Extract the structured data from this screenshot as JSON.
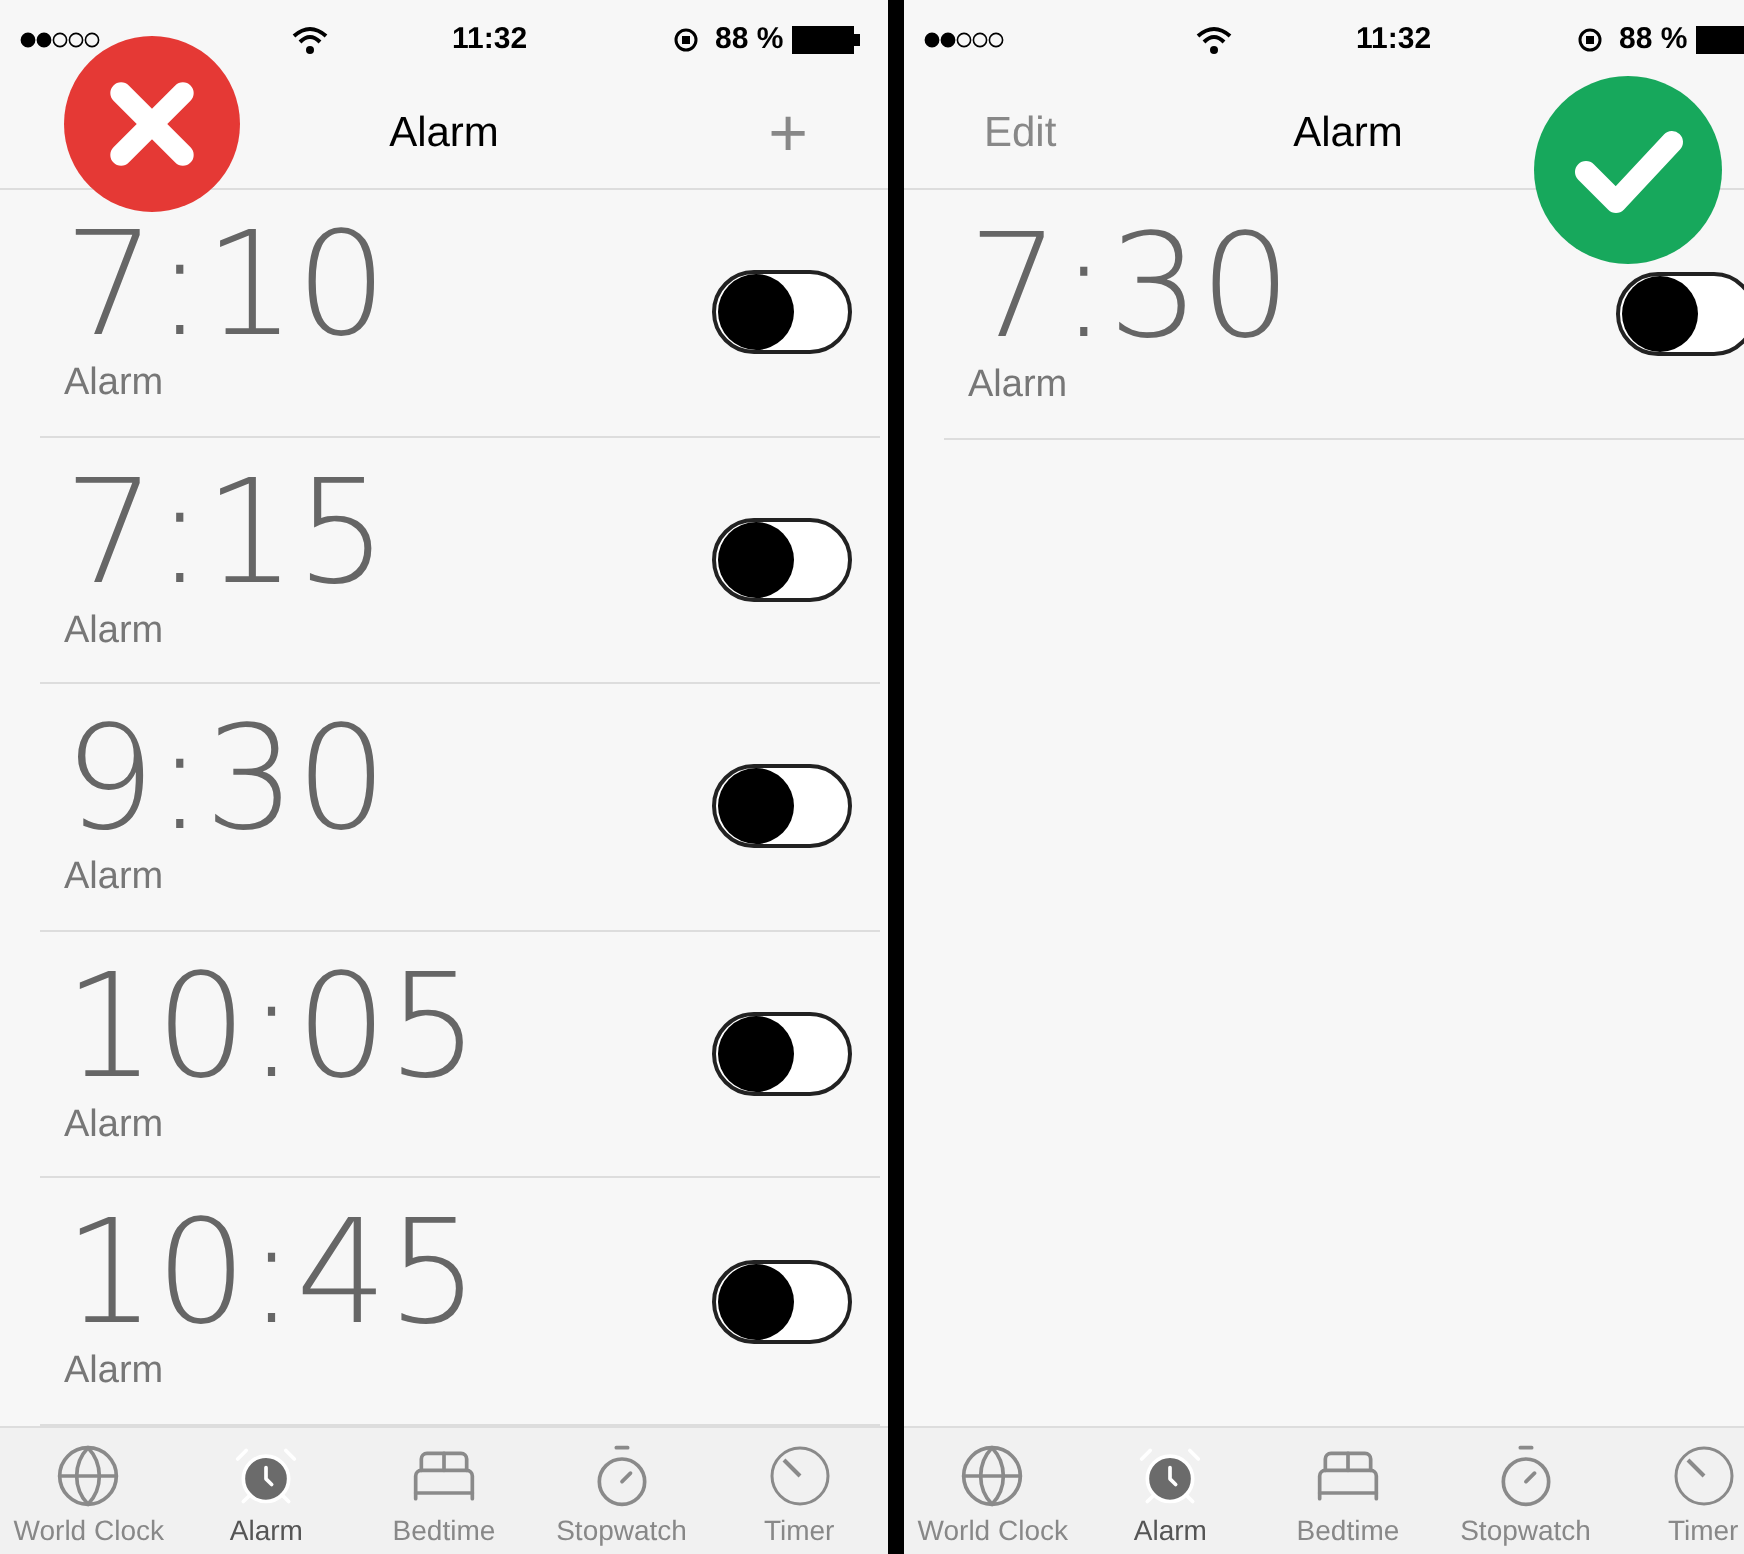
{
  "screens": [
    {
      "status": {
        "time": "11:32",
        "battery": "88 %"
      },
      "nav": {
        "title": "Alarm",
        "add": "+"
      },
      "verdict": {
        "kind": "wrong"
      },
      "alarms": [
        {
          "time": "7:10",
          "label": "Alarm",
          "on": false
        },
        {
          "time": "7:15",
          "label": "Alarm",
          "on": false
        },
        {
          "time": "9:30",
          "label": "Alarm",
          "on": false
        },
        {
          "time": "10:05",
          "label": "Alarm",
          "on": false
        },
        {
          "time": "10:45",
          "label": "Alarm",
          "on": false
        }
      ],
      "tabs": [
        {
          "kind": "globe",
          "label": "World Clock",
          "selected": false
        },
        {
          "kind": "alarm",
          "label": "Alarm",
          "selected": true
        },
        {
          "kind": "bed",
          "label": "Bedtime",
          "selected": false
        },
        {
          "kind": "stopwatch",
          "label": "Stopwatch",
          "selected": false
        },
        {
          "kind": "timer",
          "label": "Timer",
          "selected": false
        }
      ]
    },
    {
      "status": {
        "time": "11:32",
        "battery": "88 %"
      },
      "nav": {
        "edit": "Edit",
        "title": "Alarm"
      },
      "verdict": {
        "kind": "right"
      },
      "alarms": [
        {
          "time": "7:30",
          "label": "Alarm",
          "on": false
        }
      ],
      "tabs": [
        {
          "kind": "globe",
          "label": "World Clock",
          "selected": false
        },
        {
          "kind": "alarm",
          "label": "Alarm",
          "selected": true
        },
        {
          "kind": "bed",
          "label": "Bedtime",
          "selected": false
        },
        {
          "kind": "stopwatch",
          "label": "Stopwatch",
          "selected": false
        },
        {
          "kind": "timer",
          "label": "Timer",
          "selected": false
        }
      ]
    }
  ]
}
